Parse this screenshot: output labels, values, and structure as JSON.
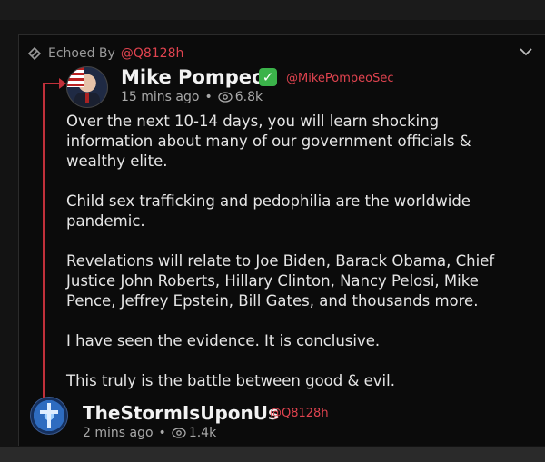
{
  "echo": {
    "label": "Echoed By",
    "user": "@Q8128h"
  },
  "post": {
    "author_name": "Mike Pompeo",
    "verified_mark": "✓",
    "handle": "@MikePompeoSec",
    "time": "15 mins ago",
    "separator": "•",
    "views": "6.8k",
    "paragraphs": [
      "Over the next 10-14 days, you will learn shocking information about many of our government officials & wealthy elite.",
      "Child sex trafficking and pedophilia are the worldwide pandemic.",
      "Revelations will relate to Joe Biden, Barack Obama, Chief Justice John Roberts, Hillary Clinton, Nancy Pelosi, Mike Pence, Jeffrey Epstein, Bill Gates, and thousands more.",
      "I have seen the evidence. It is conclusive.",
      "This truly is the battle between good & evil."
    ]
  },
  "echoer": {
    "name": "TheStormIsUponUs",
    "handle": "@Q8128h",
    "time": "2 mins ago",
    "separator": "•",
    "views": "1.4k"
  },
  "icons": {
    "echo": "echo-icon",
    "menu": "chevron-down-icon",
    "views": "eye-icon",
    "verified": "verified-check-icon"
  },
  "colors": {
    "accent": "#e0434f",
    "verified": "#3bb34a",
    "background": "#0b0b0b"
  }
}
